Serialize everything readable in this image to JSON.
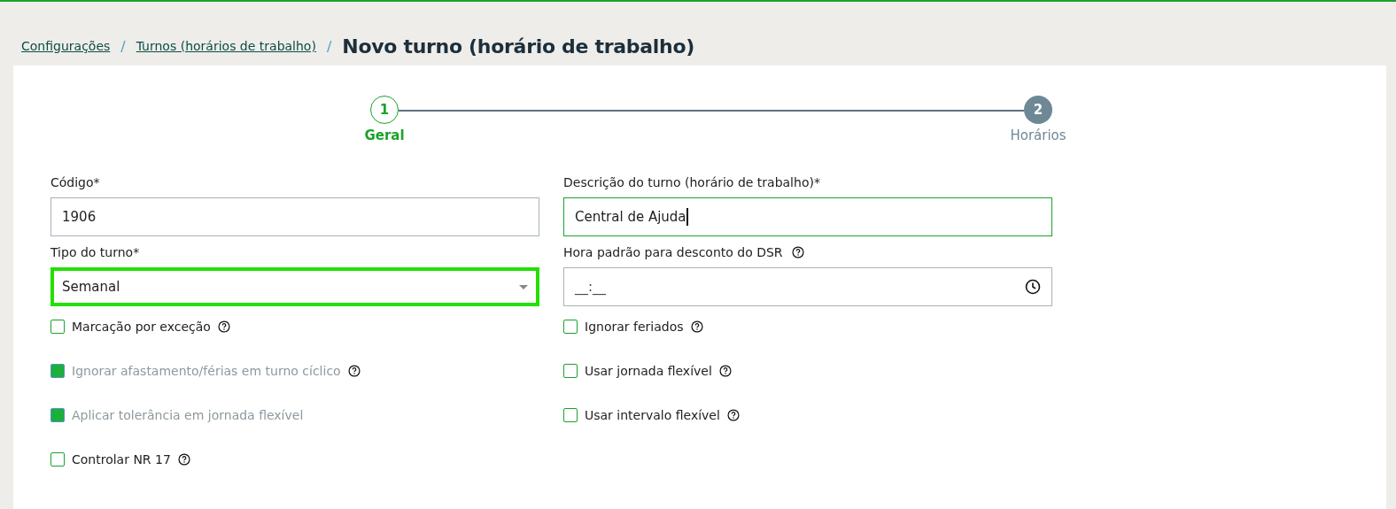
{
  "breadcrumb": {
    "links": [
      "Configurações",
      "Turnos (horários de trabalho)"
    ],
    "separator": "/",
    "title": "Novo turno (horário de trabalho)"
  },
  "stepper": [
    {
      "number": "1",
      "label": "Geral",
      "selected": true
    },
    {
      "number": "2",
      "label": "Horários",
      "selected": false
    }
  ],
  "left": {
    "fields": [
      {
        "kind": "text",
        "label": "Código*",
        "value": "1906",
        "focused": false
      },
      {
        "kind": "select",
        "label": "Tipo do turno*",
        "value": "Semanal",
        "focused": true
      }
    ],
    "checkboxes": [
      {
        "label": "Marcação por exceção",
        "checked": false,
        "disabled": false,
        "help": true
      },
      {
        "label": "Ignorar afastamento/férias em turno cíclico",
        "checked": true,
        "disabled": true,
        "help": true
      },
      {
        "label": "Aplicar tolerância em jornada flexível",
        "checked": true,
        "disabled": true,
        "help": false
      },
      {
        "label": "Controlar NR 17",
        "checked": false,
        "disabled": false,
        "help": true
      }
    ]
  },
  "right": {
    "fields": [
      {
        "kind": "text",
        "label": "Descrição do turno (horário de trabalho)*",
        "value": "Central de Ajuda",
        "focused": true
      },
      {
        "kind": "time",
        "label": "Hora padrão para desconto do DSR",
        "placeholder": "__:__",
        "help": true,
        "focused": false
      }
    ],
    "checkboxes": [
      {
        "label": "Ignorar feriados",
        "checked": false,
        "disabled": false,
        "help": true
      },
      {
        "label": "Usar jornada flexível",
        "checked": false,
        "disabled": false,
        "help": true
      },
      {
        "label": "Usar intervalo flexível",
        "checked": false,
        "disabled": false,
        "help": true
      }
    ]
  }
}
